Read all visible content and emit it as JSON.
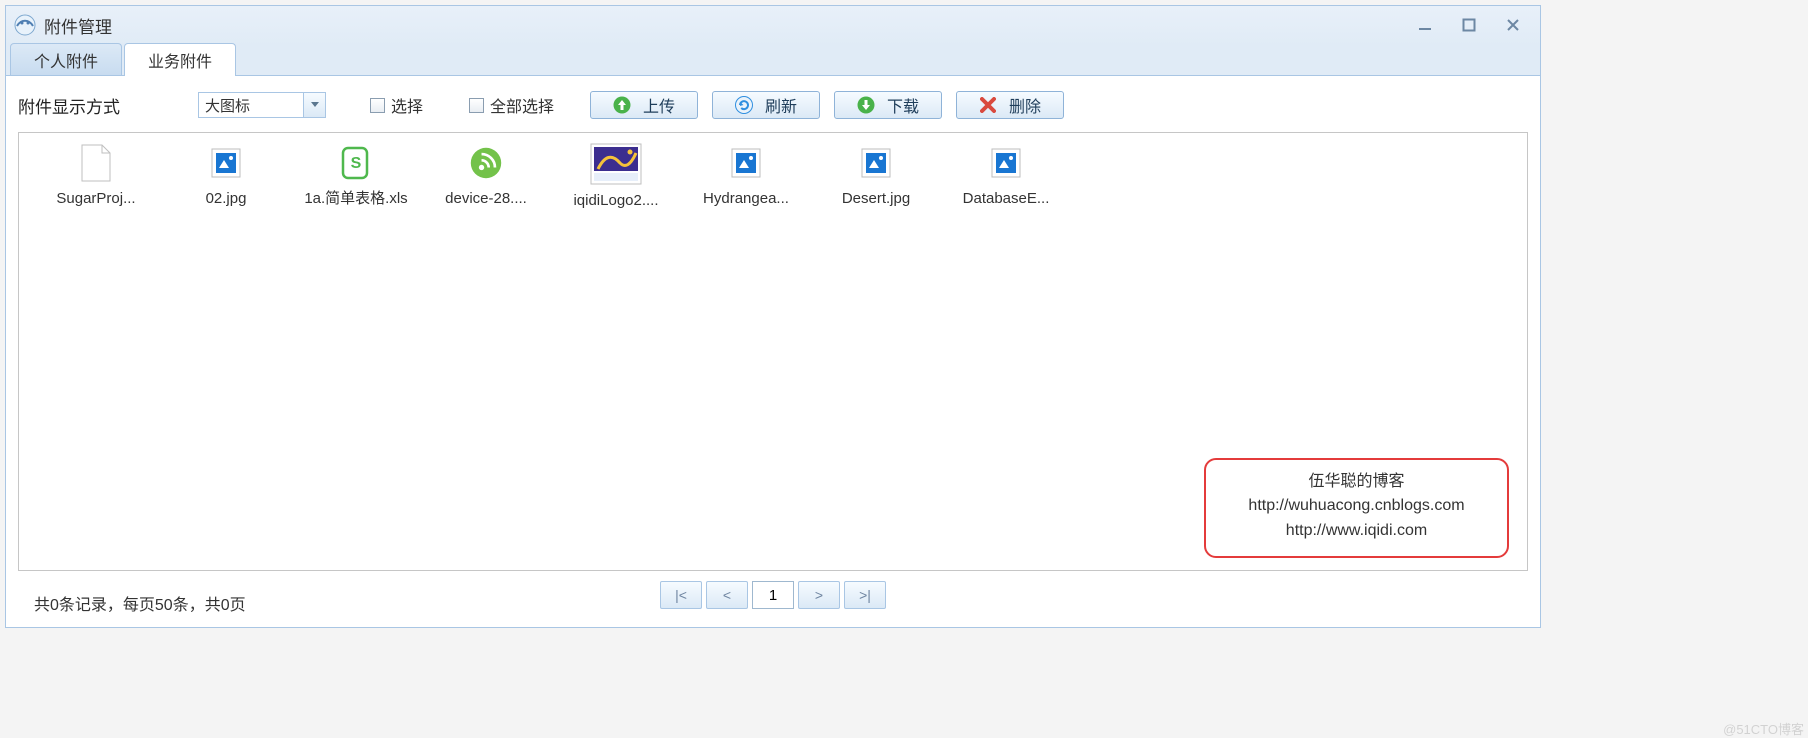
{
  "window": {
    "title": "附件管理"
  },
  "tabs": [
    {
      "label": "个人附件",
      "active": false
    },
    {
      "label": "业务附件",
      "active": true
    }
  ],
  "toolbar": {
    "display_mode_label": "附件显示方式",
    "display_mode_value": "大图标",
    "checkbox_select": "选择",
    "checkbox_select_all": "全部选择",
    "upload": "上传",
    "refresh": "刷新",
    "download": "下载",
    "delete": "删除"
  },
  "files": [
    {
      "name": "SugarProj...",
      "icon": "file-blank"
    },
    {
      "name": "02.jpg",
      "icon": "image"
    },
    {
      "name": "1a.简单表格.xls",
      "icon": "xls"
    },
    {
      "name": "device-28....",
      "icon": "wifi-green"
    },
    {
      "name": "iqidiLogo2....",
      "icon": "logo-purple"
    },
    {
      "name": "Hydrangea...",
      "icon": "image"
    },
    {
      "name": "Desert.jpg",
      "icon": "image"
    },
    {
      "name": "DatabaseE...",
      "icon": "image"
    }
  ],
  "callout": {
    "line1": "伍华聪的博客",
    "line2": "http://wuhuacong.cnblogs.com",
    "line3": "http://www.iqidi.com"
  },
  "footer": {
    "status": "共0条记录，每页50条，共0页",
    "page": "1",
    "first": "|<",
    "prev": "<",
    "next": ">",
    "last": ">|"
  },
  "external_watermark": "@51CTO博客"
}
